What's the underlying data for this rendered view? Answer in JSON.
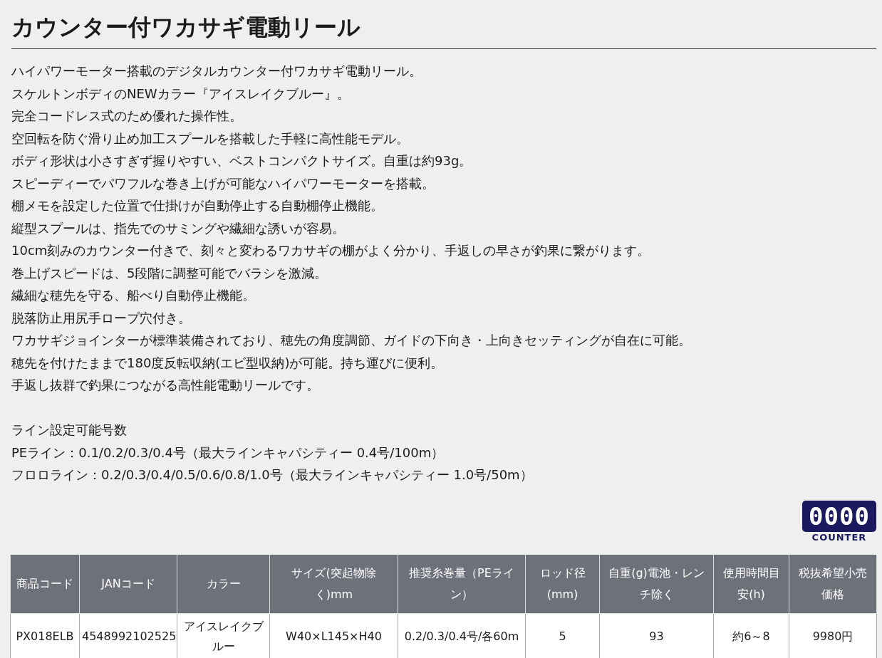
{
  "title": "カウンター付ワカサギ電動リール",
  "description": [
    "ハイパワーモーター搭載のデジタルカウンター付ワカサギ電動リール。",
    "スケルトンボディのNEWカラー『アイスレイクブルー』。",
    "完全コードレス式のため優れた操作性。",
    "空回転を防ぐ滑り止め加工スプールを搭載した手軽に高性能モデル。",
    "ボディ形状は小さすぎず握りやすい、ベストコンパクトサイズ。自重は約93g。",
    "スピーディーでパワフルな巻き上げが可能なハイパワーモーターを搭載。",
    "棚メモを設定した位置で仕掛けが自動停止する自動棚停止機能。",
    "縦型スプールは、指先でのサミングや繊細な誘いが容易。",
    "10cm刻みのカウンター付きで、刻々と変わるワカサギの棚がよく分かり、手返しの早さが釣果に繋がります。",
    "巻上げスピードは、5段階に調整可能でバラシを激減。",
    "繊細な穂先を守る、船べり自動停止機能。",
    "脱落防止用尻手ロープ穴付き。",
    "ワカサギジョインターが標準装備されており、穂先の角度調節、ガイドの下向き・上向きセッティングが自在に可能。",
    "穂先を付けたままで180度反転収納(エビ型収納)が可能。持ち運びに便利。",
    "手返し抜群で釣果につながる高性能電動リールです。"
  ],
  "line_spec": [
    "ライン設定可能号数",
    "PEライン：0.1/0.2/0.3/0.4号（最大ラインキャパシティー 0.4号/100m）",
    "フロロライン：0.2/0.3/0.4/0.5/0.6/0.8/1.0号（最大ラインキャパシティー 1.0号/50m）"
  ],
  "counter_badge": {
    "digits": "0000",
    "label": "COUNTER"
  },
  "table": {
    "columns": [
      "商品コード",
      "JANコード",
      "カラー",
      "サイズ(突起物除く)mm",
      "推奨糸巻量（PEライン）",
      "ロッド径(mm)",
      "自重(g)電池・レンチ除く",
      "使用時間目安(h)",
      "税抜希望小売価格"
    ],
    "rows": [
      [
        "PX018ELB",
        "4548992102525",
        "アイスレイクブルー",
        "W40×L145×H40",
        "0.2/0.3/0.4号/各60m",
        "5",
        "93",
        "約6～8",
        "9980円"
      ]
    ]
  }
}
